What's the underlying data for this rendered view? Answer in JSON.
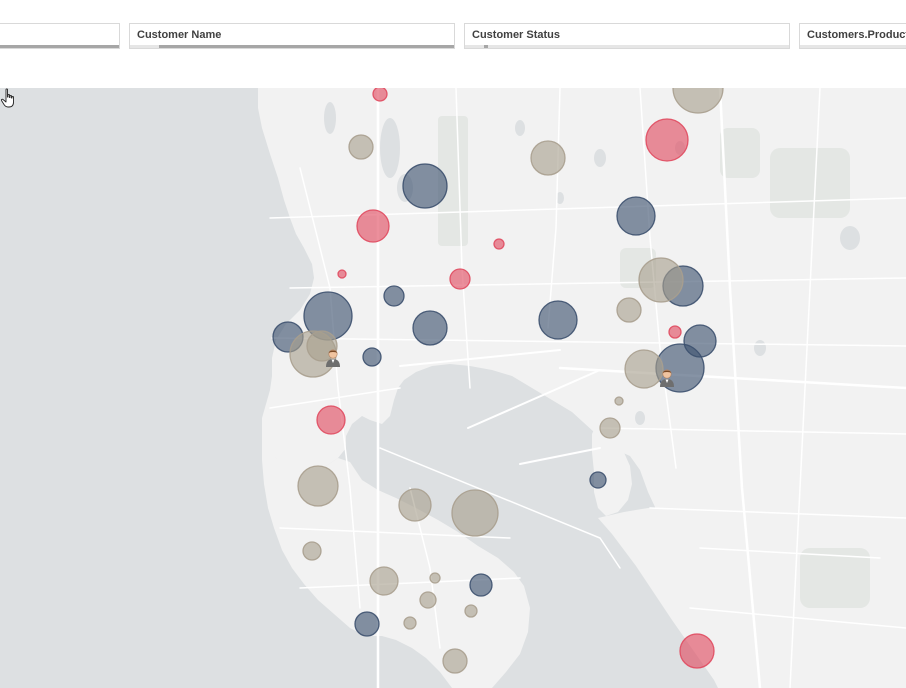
{
  "filters": [
    {
      "label": "",
      "fill": [
        0,
        1
      ]
    },
    {
      "label": "Customer Name",
      "fill": [
        0.09,
        1
      ]
    },
    {
      "label": "Customer Status",
      "fill": [
        0.06,
        0.07
      ]
    },
    {
      "label": "Customers.Product",
      "fill": [
        0,
        0
      ]
    }
  ],
  "map": {
    "colors": {
      "water": "#dde0e2",
      "land": "#f2f2f2",
      "park": "#e4e7e4",
      "road": "#ffffff",
      "red": "#e04a5f",
      "blue": "#3c506e",
      "tan": "#a89f8e"
    },
    "bubbles": [
      {
        "category": "red",
        "r": 7
      },
      {
        "category": "red",
        "r": 21
      },
      {
        "category": "red",
        "r": 16
      },
      {
        "category": "red",
        "r": 4
      },
      {
        "category": "red",
        "r": 5
      },
      {
        "category": "red",
        "r": 10
      },
      {
        "category": "red",
        "r": 14
      },
      {
        "category": "red",
        "r": 6
      },
      {
        "category": "red",
        "r": 17
      },
      {
        "category": "blue",
        "r": 22
      },
      {
        "category": "blue",
        "r": 19
      },
      {
        "category": "blue",
        "r": 10
      },
      {
        "category": "blue",
        "r": 24
      },
      {
        "category": "blue",
        "r": 17
      },
      {
        "category": "blue",
        "r": 9
      },
      {
        "category": "blue",
        "r": 19
      },
      {
        "category": "blue",
        "r": 15
      },
      {
        "category": "blue",
        "r": 20
      },
      {
        "category": "blue",
        "r": 16
      },
      {
        "category": "blue",
        "r": 24
      },
      {
        "category": "blue",
        "r": 8
      },
      {
        "category": "blue",
        "r": 11
      },
      {
        "category": "blue",
        "r": 12
      },
      {
        "category": "tan",
        "r": 25
      },
      {
        "category": "tan",
        "r": 12
      },
      {
        "category": "tan",
        "r": 17
      },
      {
        "category": "tan",
        "r": 22
      },
      {
        "category": "tan",
        "r": 12
      },
      {
        "category": "tan",
        "r": 23
      },
      {
        "category": "tan",
        "r": 19
      },
      {
        "category": "tan",
        "r": 4
      },
      {
        "category": "tan",
        "r": 10
      },
      {
        "category": "tan",
        "r": 20
      },
      {
        "category": "tan",
        "r": 16
      },
      {
        "category": "tan",
        "r": 23
      },
      {
        "category": "tan",
        "r": 9
      },
      {
        "category": "tan",
        "r": 14
      },
      {
        "category": "tan",
        "r": 5
      },
      {
        "category": "tan",
        "r": 8
      },
      {
        "category": "tan",
        "r": 6
      },
      {
        "category": "tan",
        "r": 6
      },
      {
        "category": "tan",
        "r": 12
      },
      {
        "category": "tan",
        "r": 15
      }
    ],
    "markers": [
      {
        "icon": "person-marker-icon"
      },
      {
        "icon": "person-marker-icon"
      }
    ],
    "cursor_icon": "hand-pointer-icon"
  }
}
